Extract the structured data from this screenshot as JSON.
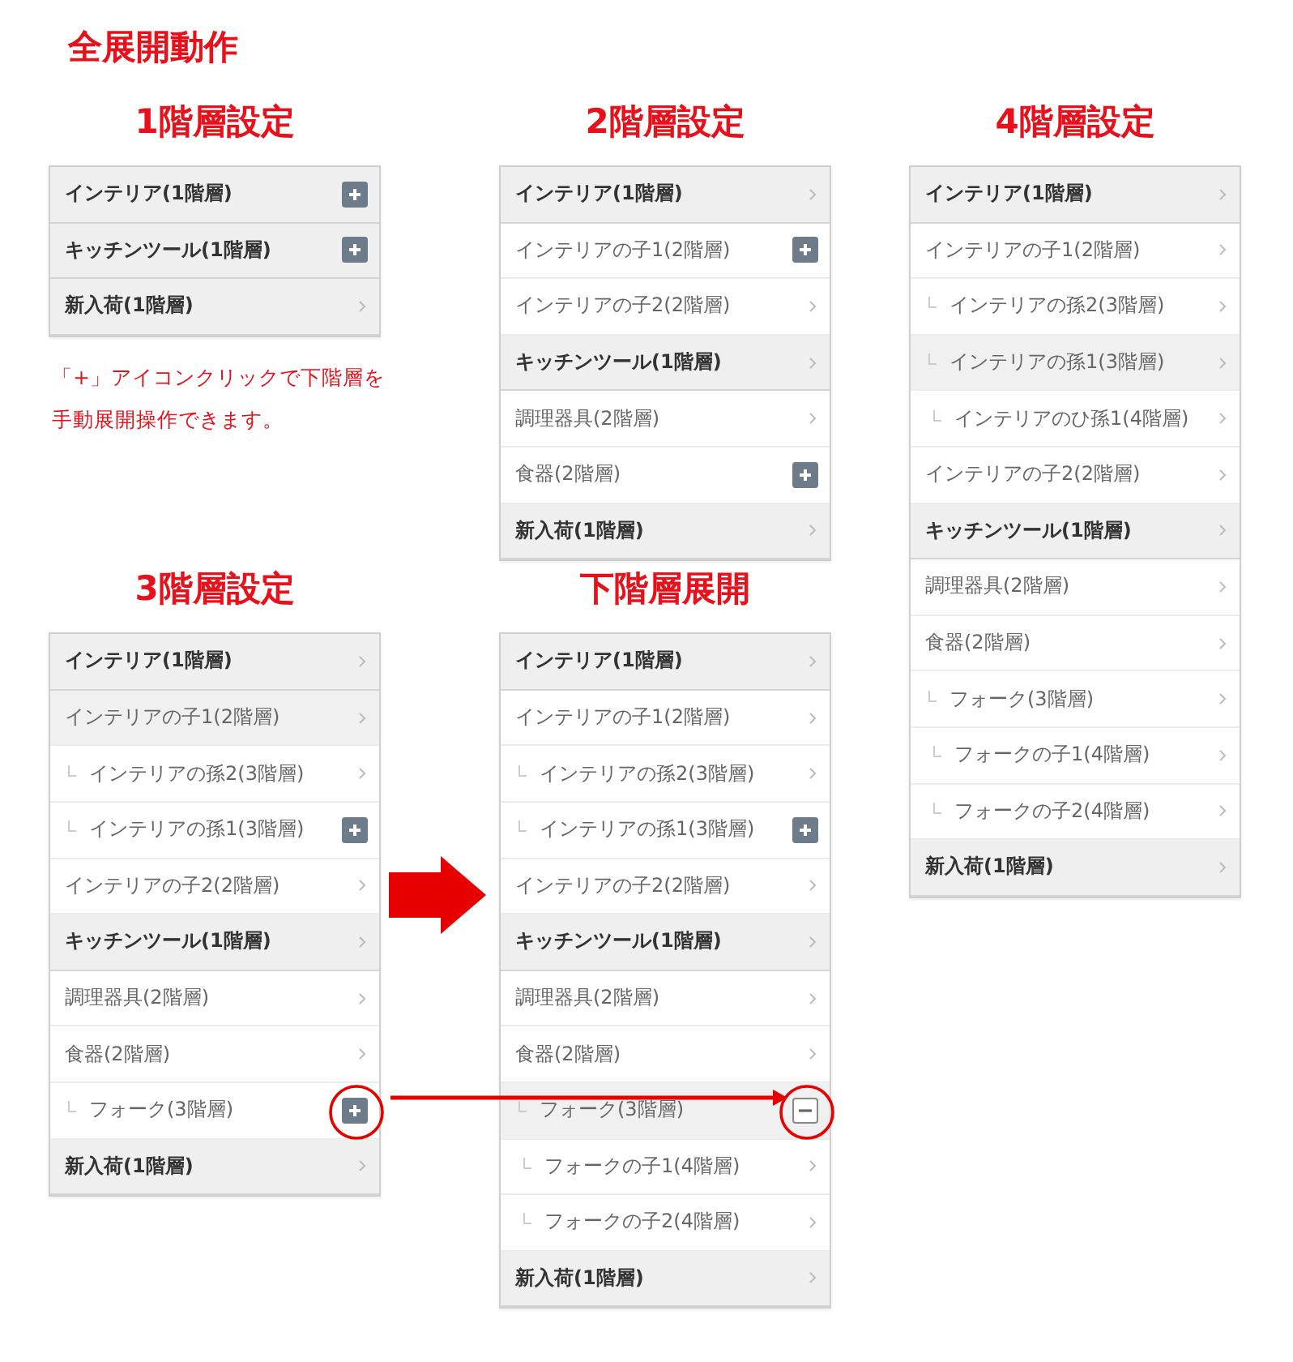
{
  "heading": "全展開動作",
  "sections": [
    {
      "title": "1階層設定",
      "note_lines": [
        "「+」アイコンクリックで下階層を",
        "手動展開操作できます。"
      ],
      "items": [
        {
          "label": "インテリア(1階層)",
          "kind": "plus",
          "highlighted": false
        },
        {
          "label": "キッチンツール(1階層)",
          "kind": "plus",
          "highlighted": false
        },
        {
          "label": "新入荷(1階層)",
          "kind": "chevron",
          "highlighted": false
        }
      ]
    },
    {
      "title": "2階層設定",
      "items": [
        {
          "label": "インテリア(1階層)",
          "kind": "chevron",
          "highlighted": false,
          "children": [
            {
              "label": "インテリアの子1(2階層)",
              "kind": "plus",
              "highlighted": false
            },
            {
              "label": "インテリアの子2(2階層)",
              "kind": "chevron",
              "highlighted": false
            }
          ]
        },
        {
          "label": "キッチンツール(1階層)",
          "kind": "chevron",
          "highlighted": false,
          "children": [
            {
              "label": "調理器具(2階層)",
              "kind": "chevron",
              "highlighted": false
            },
            {
              "label": "食器(2階層)",
              "kind": "plus",
              "highlighted": false
            }
          ]
        },
        {
          "label": "新入荷(1階層)",
          "kind": "chevron",
          "highlighted": false
        }
      ]
    },
    {
      "title": "4階層設定",
      "items": [
        {
          "label": "インテリア(1階層)",
          "kind": "chevron",
          "highlighted": false,
          "children": [
            {
              "label": "インテリアの子1(2階層)",
              "kind": "chevron",
              "highlighted": false,
              "children": [
                {
                  "label": "インテリアの孫2(3階層)",
                  "kind": "chevron",
                  "highlighted": false
                },
                {
                  "label": "インテリアの孫1(3階層)",
                  "kind": "chevron",
                  "highlighted": true,
                  "children": [
                    {
                      "label": "インテリアのひ孫1(4階層)",
                      "kind": "chevron",
                      "highlighted": false
                    }
                  ]
                }
              ]
            },
            {
              "label": "インテリアの子2(2階層)",
              "kind": "chevron",
              "highlighted": false
            }
          ]
        },
        {
          "label": "キッチンツール(1階層)",
          "kind": "chevron",
          "highlighted": false,
          "children": [
            {
              "label": "調理器具(2階層)",
              "kind": "chevron",
              "highlighted": false
            },
            {
              "label": "食器(2階層)",
              "kind": "chevron",
              "highlighted": false,
              "children": [
                {
                  "label": "フォーク(3階層)",
                  "kind": "chevron",
                  "highlighted": false,
                  "children": [
                    {
                      "label": "フォークの子1(4階層)",
                      "kind": "chevron",
                      "highlighted": false
                    },
                    {
                      "label": "フォークの子2(4階層)",
                      "kind": "chevron",
                      "highlighted": false
                    }
                  ]
                }
              ]
            }
          ]
        },
        {
          "label": "新入荷(1階層)",
          "kind": "chevron",
          "highlighted": false
        }
      ]
    },
    {
      "title": "3階層設定",
      "items": [
        {
          "label": "インテリア(1階層)",
          "kind": "chevron",
          "highlighted": false,
          "children": [
            {
              "label": "インテリアの子1(2階層)",
              "kind": "chevron",
              "highlighted": true,
              "children": [
                {
                  "label": "インテリアの孫2(3階層)",
                  "kind": "chevron",
                  "highlighted": false
                },
                {
                  "label": "インテリアの孫1(3階層)",
                  "kind": "plus",
                  "highlighted": false
                }
              ]
            },
            {
              "label": "インテリアの子2(2階層)",
              "kind": "chevron",
              "highlighted": false
            }
          ]
        },
        {
          "label": "キッチンツール(1階層)",
          "kind": "chevron",
          "highlighted": false,
          "children": [
            {
              "label": "調理器具(2階層)",
              "kind": "chevron",
              "highlighted": false
            },
            {
              "label": "食器(2階層)",
              "kind": "chevron",
              "highlighted": false,
              "children": [
                {
                  "label": "フォーク(3階層)",
                  "kind": "plus",
                  "highlighted": false
                }
              ]
            }
          ]
        },
        {
          "label": "新入荷(1階層)",
          "kind": "chevron",
          "highlighted": false
        }
      ]
    },
    {
      "title": "下階層展開",
      "items": [
        {
          "label": "インテリア(1階層)",
          "kind": "chevron",
          "highlighted": false,
          "children": [
            {
              "label": "インテリアの子1(2階層)",
              "kind": "chevron",
              "highlighted": false,
              "children": [
                {
                  "label": "インテリアの孫2(3階層)",
                  "kind": "chevron",
                  "highlighted": false
                },
                {
                  "label": "インテリアの孫1(3階層)",
                  "kind": "plus",
                  "highlighted": false
                }
              ]
            },
            {
              "label": "インテリアの子2(2階層)",
              "kind": "chevron",
              "highlighted": false
            }
          ]
        },
        {
          "label": "キッチンツール(1階層)",
          "kind": "chevron",
          "highlighted": false,
          "children": [
            {
              "label": "調理器具(2階層)",
              "kind": "chevron",
              "highlighted": false
            },
            {
              "label": "食器(2階層)",
              "kind": "chevron",
              "highlighted": false,
              "children": [
                {
                  "label": "フォーク(3階層)",
                  "kind": "minus",
                  "highlighted": true,
                  "children": [
                    {
                      "label": "フォークの子1(4階層)",
                      "kind": "chevron",
                      "highlighted": false
                    },
                    {
                      "label": "フォークの子2(4階層)",
                      "kind": "chevron",
                      "highlighted": false
                    }
                  ]
                }
              ]
            }
          ]
        },
        {
          "label": "新入荷(1階層)",
          "kind": "chevron",
          "highlighted": false
        }
      ]
    }
  ]
}
